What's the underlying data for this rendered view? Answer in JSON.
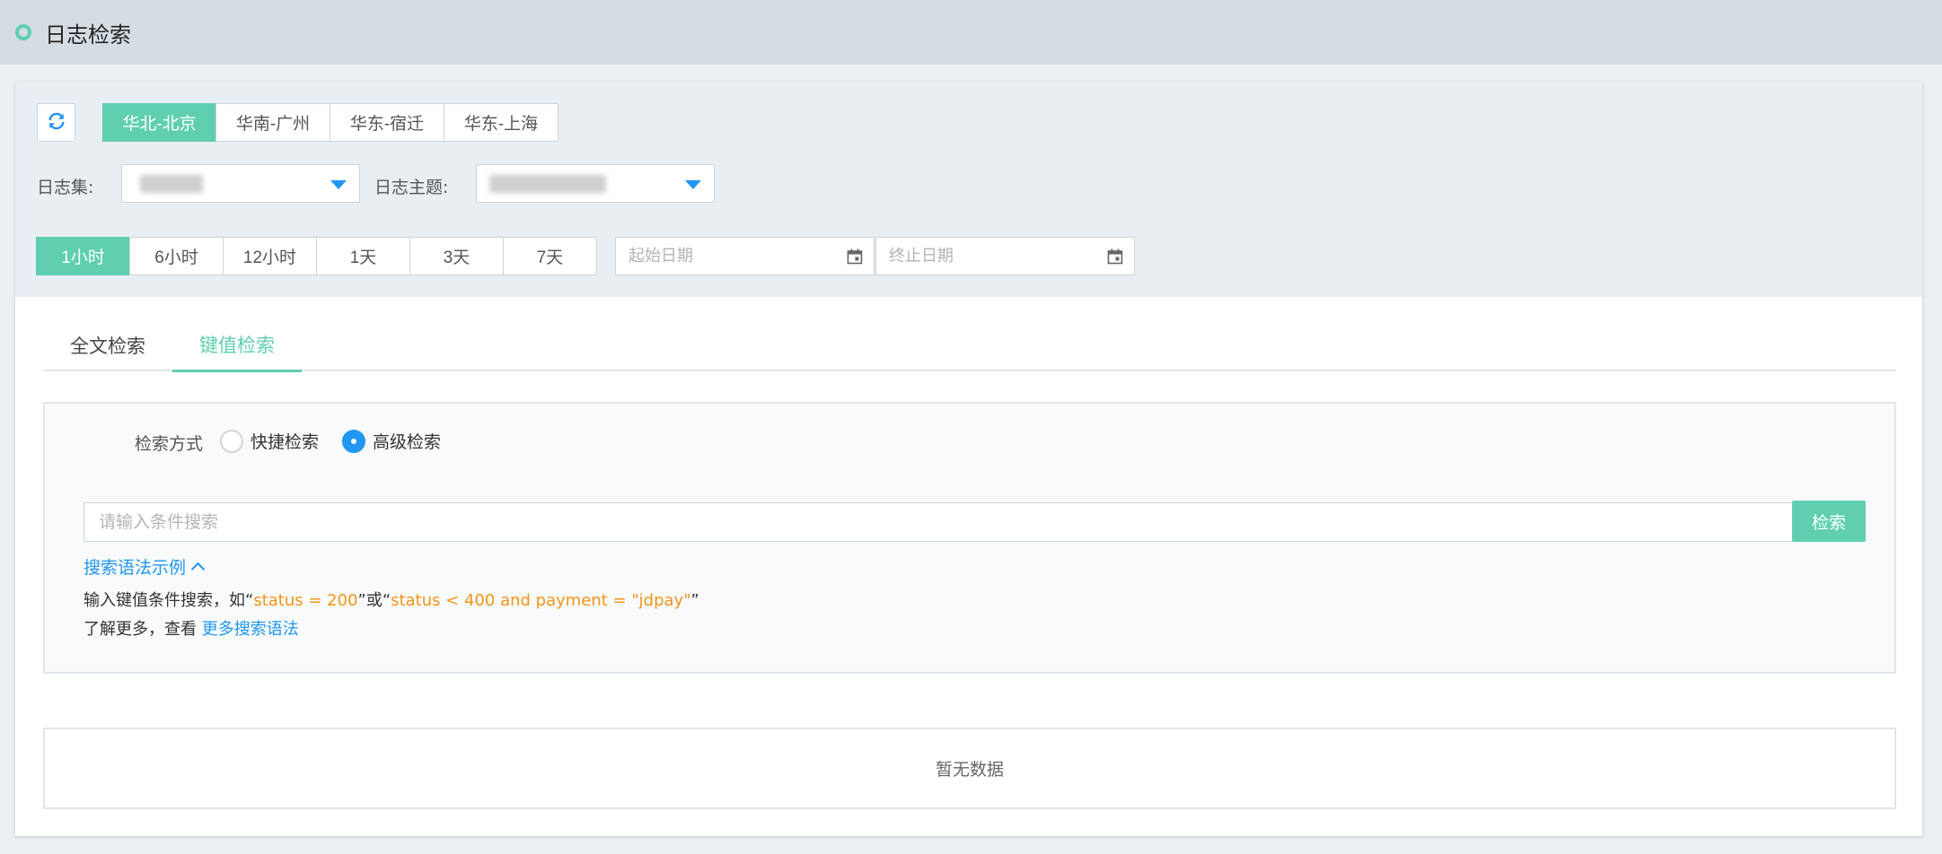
{
  "header": {
    "title": "日志检索"
  },
  "regions": {
    "items": [
      "华北-北京",
      "华南-广州",
      "华东-宿迁",
      "华东-上海"
    ],
    "active_index": 0
  },
  "filters": {
    "logset_label": "日志集:",
    "topic_label": "日志主题:"
  },
  "time_ranges": {
    "items": [
      "1小时",
      "6小时",
      "12小时",
      "1天",
      "3天",
      "7天"
    ],
    "active_index": 0
  },
  "dates": {
    "start_placeholder": "起始日期",
    "end_placeholder": "终止日期"
  },
  "tabs": {
    "items": [
      "全文检索",
      "键值检索"
    ],
    "active_index": 1
  },
  "search": {
    "method_label": "检索方式",
    "options": [
      "快捷检索",
      "高级检索"
    ],
    "selected_index": 1,
    "input_placeholder": "请输入条件搜索",
    "input_value": "",
    "button_label": "检索",
    "syntax_toggle_label": "搜索语法示例",
    "hint1": {
      "prefix": "输入键值条件搜索，如“",
      "example1": "status = 200",
      "middle": "”或“",
      "example2": "status < 400 and payment = \"jdpay\"",
      "suffix": "”"
    },
    "hint2": {
      "prefix": "了解更多，查看 ",
      "link": "更多搜索语法"
    }
  },
  "results": {
    "empty_text": "暂无数据"
  },
  "colors": {
    "accent": "#5fcfb0",
    "link": "#2196f3",
    "code": "#f39418"
  }
}
